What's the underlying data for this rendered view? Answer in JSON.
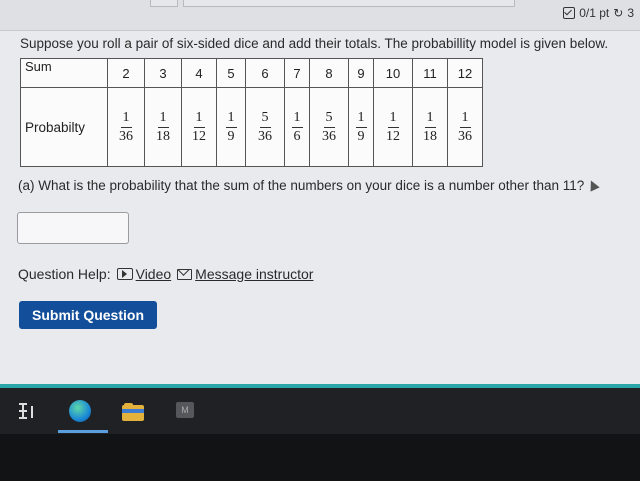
{
  "header": {
    "score_text": "0/1 pt",
    "retry_count": "3"
  },
  "question": {
    "intro": "Suppose you roll a pair of six-sided dice and add their totals. The probabillity model is given below.",
    "part_a": "(a) What is the probability that the sum of the numbers on your dice is a number other than 11?",
    "answer_value": ""
  },
  "table": {
    "row1_label": "Sum",
    "row2_label": "Probabilty",
    "sums": [
      "2",
      "3",
      "4",
      "5",
      "6",
      "7",
      "8",
      "9",
      "10",
      "11",
      "12"
    ],
    "probabilities": [
      {
        "num": "1",
        "den": "36"
      },
      {
        "num": "1",
        "den": "18"
      },
      {
        "num": "1",
        "den": "12"
      },
      {
        "num": "1",
        "den": "9"
      },
      {
        "num": "5",
        "den": "36"
      },
      {
        "num": "1",
        "den": "6"
      },
      {
        "num": "5",
        "den": "36"
      },
      {
        "num": "1",
        "den": "9"
      },
      {
        "num": "1",
        "den": "12"
      },
      {
        "num": "1",
        "den": "18"
      },
      {
        "num": "1",
        "den": "36"
      }
    ]
  },
  "help": {
    "label": "Question Help:",
    "video": "Video",
    "message": "Message instructor"
  },
  "actions": {
    "submit": "Submit Question"
  },
  "taskbar": {
    "app_letter": "M"
  },
  "colors": {
    "submit_bg": "#124e9a",
    "accent_line": "#2aa6a8",
    "page_bg": "#e9eaee"
  }
}
